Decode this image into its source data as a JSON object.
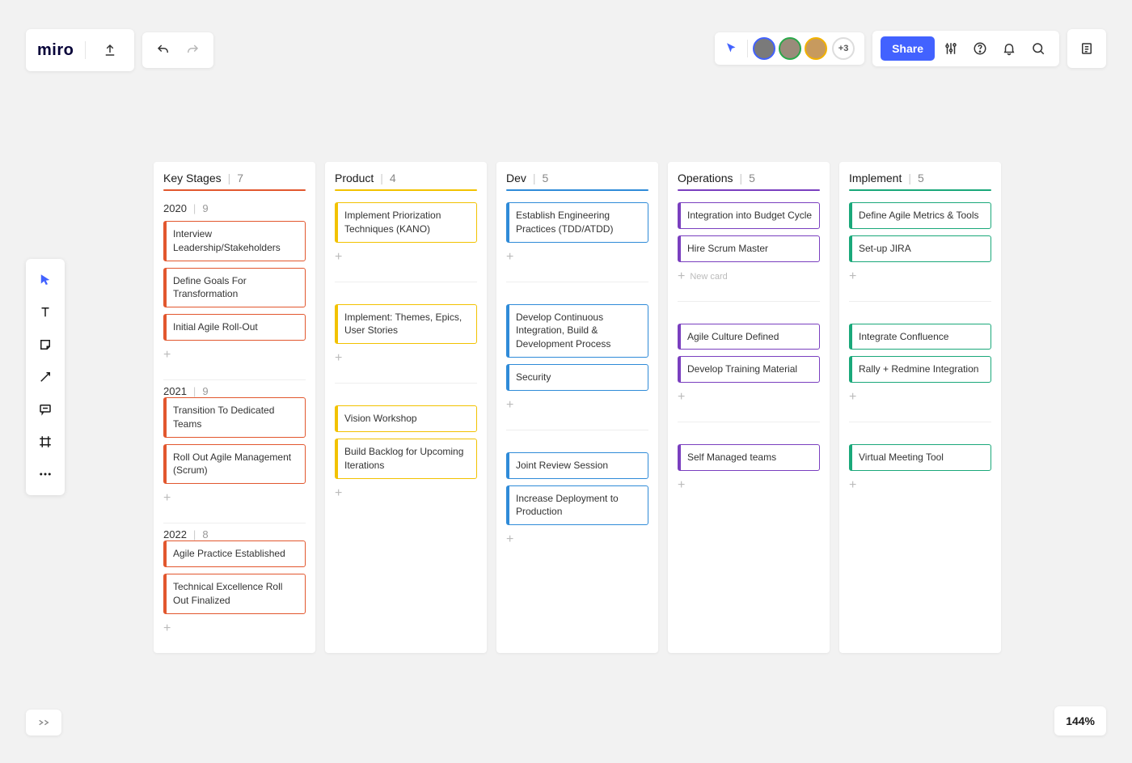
{
  "app": {
    "logo": "miro"
  },
  "topRight": {
    "shareLabel": "Share",
    "overflowCount": "+3",
    "avatars": [
      {
        "border": "#4262ff",
        "bg": "#7a7a7a"
      },
      {
        "border": "#2aa84a",
        "bg": "#9a8b7a"
      },
      {
        "border": "#f2b200",
        "bg": "#c79a5e"
      }
    ]
  },
  "zoom": "144%",
  "columns": [
    {
      "title": "Key Stages",
      "count": "7",
      "color": "#e2572e"
    },
    {
      "title": "Product",
      "count": "4",
      "color": "#f2c200"
    },
    {
      "title": "Dev",
      "count": "5",
      "color": "#2f8bd8"
    },
    {
      "title": "Operations",
      "count": "5",
      "color": "#7a3fbf"
    },
    {
      "title": "Implement",
      "count": "5",
      "color": "#1aa87a"
    }
  ],
  "swimlanes": [
    {
      "year": "2020",
      "count": "9"
    },
    {
      "year": "2021",
      "count": "9"
    },
    {
      "year": "2022",
      "count": "8"
    }
  ],
  "addCardLabel": "New card",
  "cards": {
    "2020": {
      "Key Stages": [
        "Interview Leadership/Stakeholders",
        "Define Goals For Transformation",
        "Initial Agile Roll-Out"
      ],
      "Product": [
        "Implement Priorization Techniques (KANO)"
      ],
      "Dev": [
        "Establish Engineering Practices (TDD/ATDD)"
      ],
      "Operations": [
        "Integration into Budget Cycle",
        "Hire Scrum Master"
      ],
      "Implement": [
        "Define Agile Metrics & Tools",
        "Set-up JIRA"
      ]
    },
    "2021": {
      "Key Stages": [
        "Transition To Dedicated Teams",
        "Roll Out Agile Management (Scrum)"
      ],
      "Product": [
        "Implement: Themes, Epics, User Stories"
      ],
      "Dev": [
        "Develop Continuous Integration, Build & Development Process",
        "Security"
      ],
      "Operations": [
        "Agile Culture Defined",
        "Develop Training Material"
      ],
      "Implement": [
        "Integrate Confluence",
        "Rally + Redmine Integration"
      ]
    },
    "2022": {
      "Key Stages": [
        "Agile Practice Established",
        "Technical Excellence Roll Out Finalized"
      ],
      "Product": [
        "Vision Workshop",
        "Build Backlog for Upcoming Iterations"
      ],
      "Dev": [
        "Joint Review Session",
        "Increase Deployment to Production"
      ],
      "Operations": [
        "Self Managed teams"
      ],
      "Implement": [
        "Virtual Meeting Tool"
      ]
    }
  }
}
